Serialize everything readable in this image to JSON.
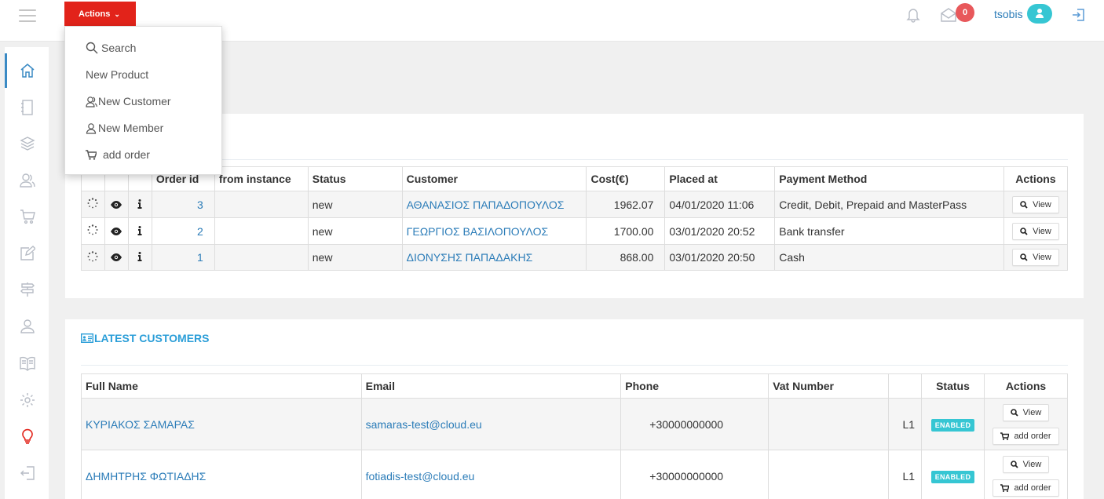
{
  "topbar": {
    "actions_label": "Actions",
    "message_count": "0",
    "username": "tsobis"
  },
  "dropdown": {
    "items": [
      {
        "label": "Search",
        "icon": "search-icon"
      },
      {
        "label": "New Product",
        "icon": ""
      },
      {
        "label": "New Customer",
        "icon": "users-icon"
      },
      {
        "label": "New Member",
        "icon": "user-icon"
      },
      {
        "label": "add order",
        "icon": "cart-icon"
      }
    ]
  },
  "sidebar": {
    "items": [
      "home-icon",
      "notebook-icon",
      "layers-icon",
      "users-icon",
      "cart-icon",
      "edit-icon",
      "signpost-icon",
      "user-icon",
      "book-icon",
      "gear-icon",
      "bulb-icon",
      "logout-icon"
    ]
  },
  "orders": {
    "headers": [
      "Order id",
      "from instance",
      "Status",
      "Customer",
      "Cost(€)",
      "Placed at",
      "Payment Method",
      "Actions"
    ],
    "rows": [
      {
        "id": "3",
        "instance": "",
        "status": "new",
        "customer": "ΑΘΑΝΑΣΙΟΣ ΠΑΠΑΔΟΠΟΥΛΟΣ",
        "cost": "1962.07",
        "placed": "04/01/2020 11:06",
        "payment": "Credit, Debit, Prepaid and MasterPass",
        "action": "View"
      },
      {
        "id": "2",
        "instance": "",
        "status": "new",
        "customer": "ΓΕΩΡΓΙΟΣ ΒΑΣΙΛΟΠΟΥΛΟΣ",
        "cost": "1700.00",
        "placed": "03/01/2020 20:52",
        "payment": "Bank transfer",
        "action": "View"
      },
      {
        "id": "1",
        "instance": "",
        "status": "new",
        "customer": "ΔΙΟΝΥΣΗΣ ΠΑΠΑΔΑΚΗΣ",
        "cost": "868.00",
        "placed": "03/01/2020 20:50",
        "payment": "Cash",
        "action": "View"
      }
    ]
  },
  "customers": {
    "title": "LATEST CUSTOMERS",
    "headers": [
      "Full Name",
      "Email",
      "Phone",
      "Vat Number",
      "",
      "Status",
      "Actions"
    ],
    "rows": [
      {
        "name": "ΚΥΡΙΑΚΟΣ ΣΑΜΑΡΑΣ",
        "email": "samaras-test@cloud.eu",
        "phone": "+30000000000",
        "vat": "",
        "level": "L1",
        "status": "ENABLED",
        "view": "View",
        "add_order": "add order"
      },
      {
        "name": "ΔΗΜΗΤΡΗΣ ΦΩΤΙΑΔΗΣ",
        "email": "fotiadis-test@cloud.eu",
        "phone": "+30000000000",
        "vat": "",
        "level": "L1",
        "status": "ENABLED",
        "view": "View",
        "add_order": "add order"
      }
    ]
  },
  "colors": {
    "accent_red": "#e2231a",
    "link_blue": "#2b7cb8",
    "status_teal": "#36c6d3",
    "badge_red": "#e8585b"
  }
}
